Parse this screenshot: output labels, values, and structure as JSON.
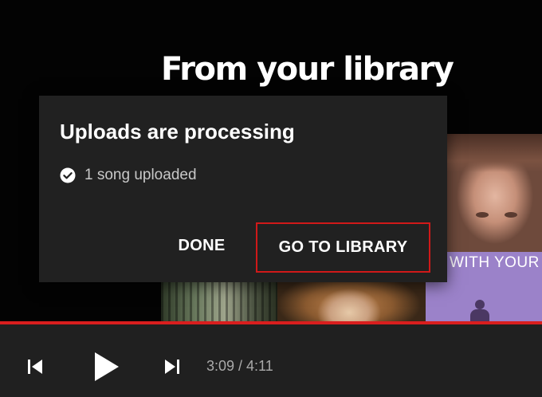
{
  "background": {
    "section_title": "From your library"
  },
  "album_art": {
    "purple_tile_text": "WITH YOUR"
  },
  "dialog": {
    "title": "Uploads are processing",
    "status_text": "1 song uploaded",
    "status_icon": "check-circle-icon",
    "done_label": "DONE",
    "go_to_library_label": "GO TO LIBRARY",
    "highlight_color": "#d01919"
  },
  "player": {
    "time": "3:09 / 4:11",
    "progress_fraction": 1.0,
    "progress_color": "#d91e1e",
    "icons": [
      "skip-previous-icon",
      "play-icon",
      "skip-next-icon"
    ]
  }
}
